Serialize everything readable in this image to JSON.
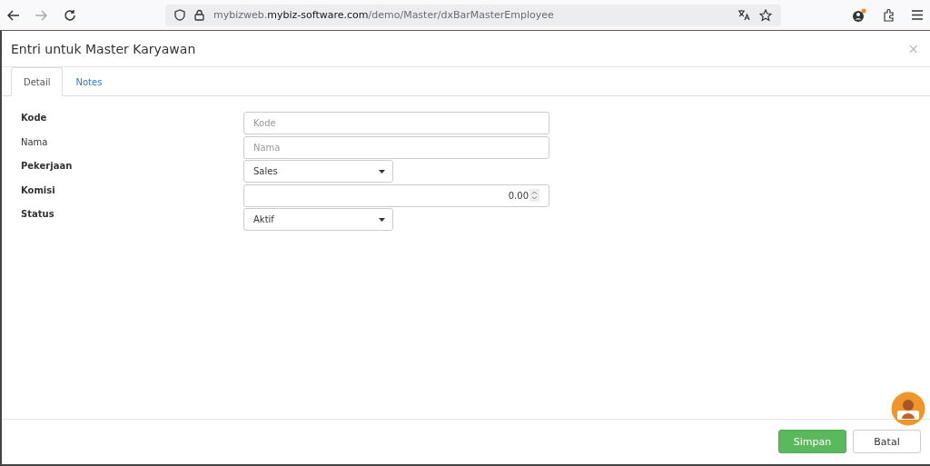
{
  "browser": {
    "url_host_prefix": "mybizweb.",
    "url_domain": "mybiz-software.com",
    "url_path": "/demo/Master/dxBarMasterEmployee"
  },
  "dialog": {
    "title": "Entri untuk Master Karyawan",
    "close": "×"
  },
  "tabs": [
    {
      "label": "Detail",
      "selected": true
    },
    {
      "label": "Notes",
      "selected": false
    }
  ],
  "fields": [
    {
      "label": "Kode",
      "required": true,
      "kind": "text",
      "placeholder": "Kode",
      "wide": true
    },
    {
      "label": "Nama",
      "required": false,
      "kind": "text",
      "placeholder": "Nama",
      "wide": true
    },
    {
      "label": "Pekerjaan",
      "required": true,
      "kind": "select",
      "value": "Sales",
      "wide": false
    },
    {
      "label": "Komisi",
      "required": true,
      "kind": "number",
      "value": "0.00",
      "wide": true
    },
    {
      "label": "Status",
      "required": true,
      "kind": "select",
      "value": "Aktif",
      "wide": false
    }
  ],
  "buttons": [
    {
      "label": "Simpan",
      "kind": "primary"
    },
    {
      "label": "Batal",
      "kind": "default"
    }
  ]
}
